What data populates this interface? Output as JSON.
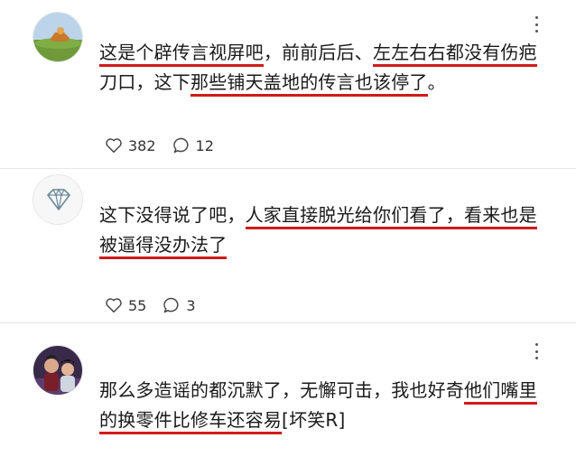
{
  "comments": [
    {
      "avatar_icon": "landscape-avatar",
      "line1_plain": "",
      "line1_segments": [
        {
          "t": "这是个辟传言视屏吧",
          "hl": true
        },
        {
          "t": "，前前后后、",
          "hl": false
        },
        {
          "t": "左左右右都没有伤疤",
          "hl": true
        }
      ],
      "line2_segments": [
        {
          "t": "刀口，这下",
          "hl": false
        },
        {
          "t": "那些铺天盖地的传言也该停了",
          "hl": true
        },
        {
          "t": "。",
          "hl": false
        }
      ],
      "likes": "382",
      "replies": "12"
    },
    {
      "avatar_icon": "diamond-avatar",
      "line1_segments": [
        {
          "t": "这下没得说了吧，",
          "hl": false
        },
        {
          "t": "人家直接脱光给你们看了，看来也是",
          "hl": true
        }
      ],
      "line2_segments": [
        {
          "t": "被逼得没办法了",
          "hl": true
        }
      ],
      "likes": "55",
      "replies": "3"
    },
    {
      "avatar_icon": "people-photo-avatar",
      "line1_segments": [
        {
          "t": "那么多造谣的都沉默了，无懈可击，我也好奇",
          "hl": false
        },
        {
          "t": "他们嘴里",
          "hl": true
        }
      ],
      "line2_segments": [
        {
          "t": "的换零件比修车还容易",
          "hl": true
        },
        {
          "t": "[坏笑R]",
          "hl": false
        }
      ]
    }
  ],
  "colors": {
    "highlight_underline": "#d11a1a",
    "text": "#1a1a1a"
  }
}
